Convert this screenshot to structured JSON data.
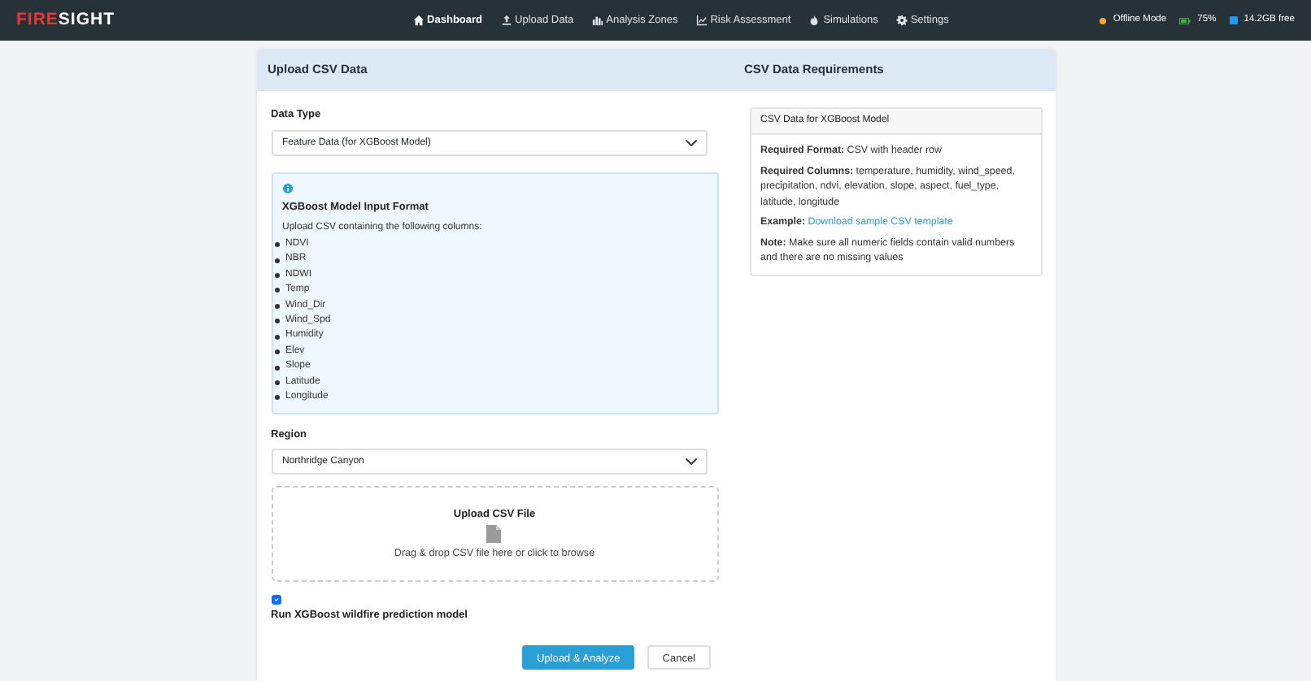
{
  "navbar": {
    "brand": {
      "first": "FIRE",
      "second": "SIGHT"
    },
    "items": [
      {
        "label": "Dashboard",
        "selected": true
      },
      {
        "label": "Upload Data",
        "selected": false
      },
      {
        "label": "Analysis Zones",
        "selected": false
      },
      {
        "label": "Risk Assessment",
        "selected": false
      },
      {
        "label": "Simulations",
        "selected": false
      },
      {
        "label": "Settings",
        "selected": false
      }
    ],
    "status": {
      "mode": {
        "label": "Offline Mode",
        "color": "#f5a623"
      },
      "battery": "75%",
      "storage": "14.2GB free"
    }
  },
  "upload_panel": {
    "title": "Upload CSV Data",
    "data_type": {
      "label": "Data Type",
      "value": "Feature Data (for XGBoost Model)"
    },
    "info": {
      "title": "XGBoost Model Input Format",
      "intro": "Upload CSV containing the following columns:",
      "columns": [
        "NDVI",
        "NBR",
        "NDWI",
        "Temp",
        "Wind_Dir",
        "Wind_Spd",
        "Humidity",
        "Elev",
        "Slope",
        "Latitude",
        "Longitude"
      ]
    },
    "region": {
      "label": "Region",
      "value": "Northridge Canyon"
    },
    "dropzone": {
      "title": "Upload CSV File",
      "hint": "Drag & drop CSV file here or click to browse"
    },
    "run_model": {
      "label": "Run XGBoost wildfire prediction model",
      "checked": true
    },
    "buttons": [
      {
        "label": "Upload & Analyze",
        "kind": "primary"
      },
      {
        "label": "Cancel",
        "kind": "secondary"
      }
    ]
  },
  "requirements_panel": {
    "title": "CSV Data Requirements",
    "card": {
      "title": "CSV Data for XGBoost Model",
      "lines": [
        "**Required Format:** CSV with header row",
        "**Required Columns:** temperature, humidity, wind_speed, precipitation, ndvi, elevation, slope, aspect, fuel_type, latitude, longitude"
      ],
      "example": {
        "label": "Example:",
        "link": "Download sample CSV template"
      },
      "note": "**Note:** Make sure all numeric fields contain valid numbers and there are no missing values"
    }
  }
}
